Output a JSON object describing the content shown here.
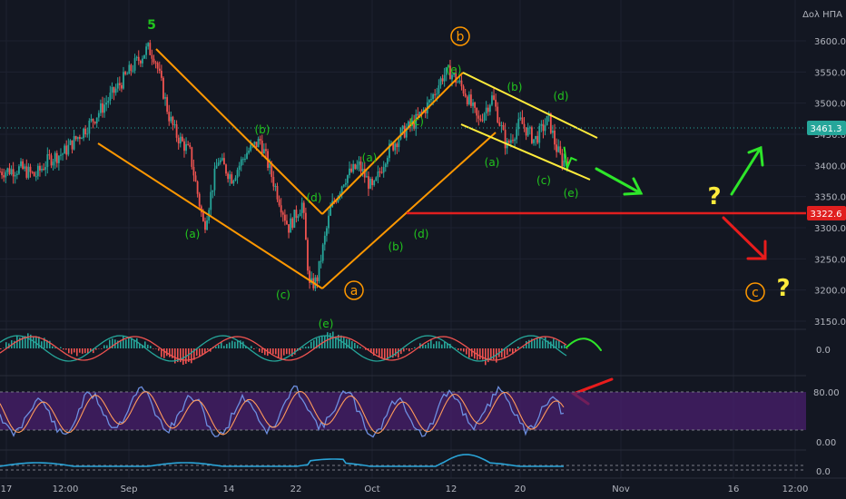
{
  "chart_data": {
    "type": "line",
    "symbol_label": "Δολ ΗΠΑ",
    "instrument_note": "price chart with Elliott Wave annotations, MACD, Stochastic RSI and a third oscillator",
    "y_ticks": [
      "3600.0",
      "3550.0",
      "3500.0",
      "3450.0",
      "3400.0",
      "3350.0",
      "3300.0",
      "3250.0",
      "3200.0",
      "3150.0"
    ],
    "ylim": [
      3130,
      3620
    ],
    "current_price": "3461.3",
    "level_price": "3322.6",
    "x_ticks": [
      "17",
      "12:00",
      "Sep",
      "14",
      "22",
      "Oct",
      "12",
      "20",
      "Nov",
      "16",
      "12:00"
    ],
    "price_path": [
      {
        "t": 0,
        "p": 3390
      },
      {
        "t": 3,
        "p": 3395
      },
      {
        "t": 5,
        "p": 3383
      },
      {
        "t": 7,
        "p": 3410
      },
      {
        "t": 9,
        "p": 3420
      },
      {
        "t": 11,
        "p": 3445
      },
      {
        "t": 13,
        "p": 3470
      },
      {
        "t": 15,
        "p": 3500
      },
      {
        "t": 17,
        "p": 3530
      },
      {
        "t": 19,
        "p": 3560
      },
      {
        "t": 21,
        "p": 3588
      },
      {
        "t": 22,
        "p": 3575
      },
      {
        "t": 24,
        "p": 3480
      },
      {
        "t": 25,
        "p": 3450
      },
      {
        "t": 27,
        "p": 3420
      },
      {
        "t": 29,
        "p": 3300
      },
      {
        "t": 31,
        "p": 3410
      },
      {
        "t": 33,
        "p": 3380
      },
      {
        "t": 35,
        "p": 3420
      },
      {
        "t": 37,
        "p": 3440
      },
      {
        "t": 39,
        "p": 3370
      },
      {
        "t": 41,
        "p": 3300
      },
      {
        "t": 43,
        "p": 3340
      },
      {
        "t": 44,
        "p": 3205
      },
      {
        "t": 45,
        "p": 3215
      },
      {
        "t": 47,
        "p": 3330
      },
      {
        "t": 49,
        "p": 3380
      },
      {
        "t": 51,
        "p": 3400
      },
      {
        "t": 53,
        "p": 3360
      },
      {
        "t": 55,
        "p": 3420
      },
      {
        "t": 57,
        "p": 3450
      },
      {
        "t": 59,
        "p": 3470
      },
      {
        "t": 61,
        "p": 3500
      },
      {
        "t": 63,
        "p": 3545
      },
      {
        "t": 64,
        "p": 3550
      },
      {
        "t": 66,
        "p": 3520
      },
      {
        "t": 68,
        "p": 3470
      },
      {
        "t": 70,
        "p": 3510
      },
      {
        "t": 72,
        "p": 3430
      },
      {
        "t": 74,
        "p": 3470
      },
      {
        "t": 76,
        "p": 3440
      },
      {
        "t": 78,
        "p": 3475
      },
      {
        "t": 79,
        "p": 3430
      },
      {
        "t": 80,
        "p": 3405
      },
      {
        "t": 81,
        "p": 3415
      }
    ],
    "annotations": [
      {
        "id": "w5",
        "text": "5",
        "color": "#22c41e"
      },
      {
        "id": "b_main",
        "text": "b",
        "color": "#ff9800"
      },
      {
        "id": "a_main",
        "text": "a",
        "color": "#ff9800"
      },
      {
        "id": "c_main",
        "text": "c",
        "color": "#ff9800"
      },
      {
        "id": "b1",
        "text": "(b)",
        "color": "#22c41e"
      },
      {
        "id": "a1",
        "text": "(a)",
        "color": "#22c41e"
      },
      {
        "id": "c1",
        "text": "(c)",
        "color": "#22c41e"
      },
      {
        "id": "d1",
        "text": "(d)",
        "color": "#22c41e"
      },
      {
        "id": "e1",
        "text": "(e)",
        "color": "#22c41e"
      },
      {
        "id": "a2",
        "text": "(a)",
        "color": "#22c41e"
      },
      {
        "id": "b2",
        "text": "(b)",
        "color": "#22c41e"
      },
      {
        "id": "c2",
        "text": "(c)",
        "color": "#22c41e"
      },
      {
        "id": "d2",
        "text": "(d)",
        "color": "#22c41e"
      },
      {
        "id": "e2",
        "text": "(e)",
        "color": "#22c41e"
      },
      {
        "id": "a3",
        "text": "(a)",
        "color": "#22c41e"
      },
      {
        "id": "b3",
        "text": "(b)",
        "color": "#22c41e"
      },
      {
        "id": "c3",
        "text": "(c)",
        "color": "#22c41e"
      },
      {
        "id": "d3",
        "text": "(d)",
        "color": "#22c41e"
      },
      {
        "id": "e3",
        "text": "(e)",
        "color": "#22c41e"
      },
      {
        "id": "q1",
        "text": "?",
        "color": "#ffeb3b"
      },
      {
        "id": "q2",
        "text": "?",
        "color": "#ffeb3b"
      }
    ],
    "macd_tick": "0.0",
    "stoch_ticks": [
      "80.00",
      "0.00"
    ],
    "osc3_tick": "0.0",
    "colors": {
      "background": "#131722",
      "grid": "#1e2230",
      "axis_text": "#b2b5be",
      "up": "#26a69a",
      "down": "#ef5350",
      "channel": "#ff9800",
      "wedge": "#ffeb3b",
      "level": "#e01f1f",
      "green_arrow": "#2ee62a",
      "red_arrow": "#e81c1c",
      "stoch_band": "#4a1f6e",
      "stoch_k": "#6d8ee0",
      "stoch_d": "#ff9a5a",
      "osc3": "#2aa3d6"
    }
  }
}
